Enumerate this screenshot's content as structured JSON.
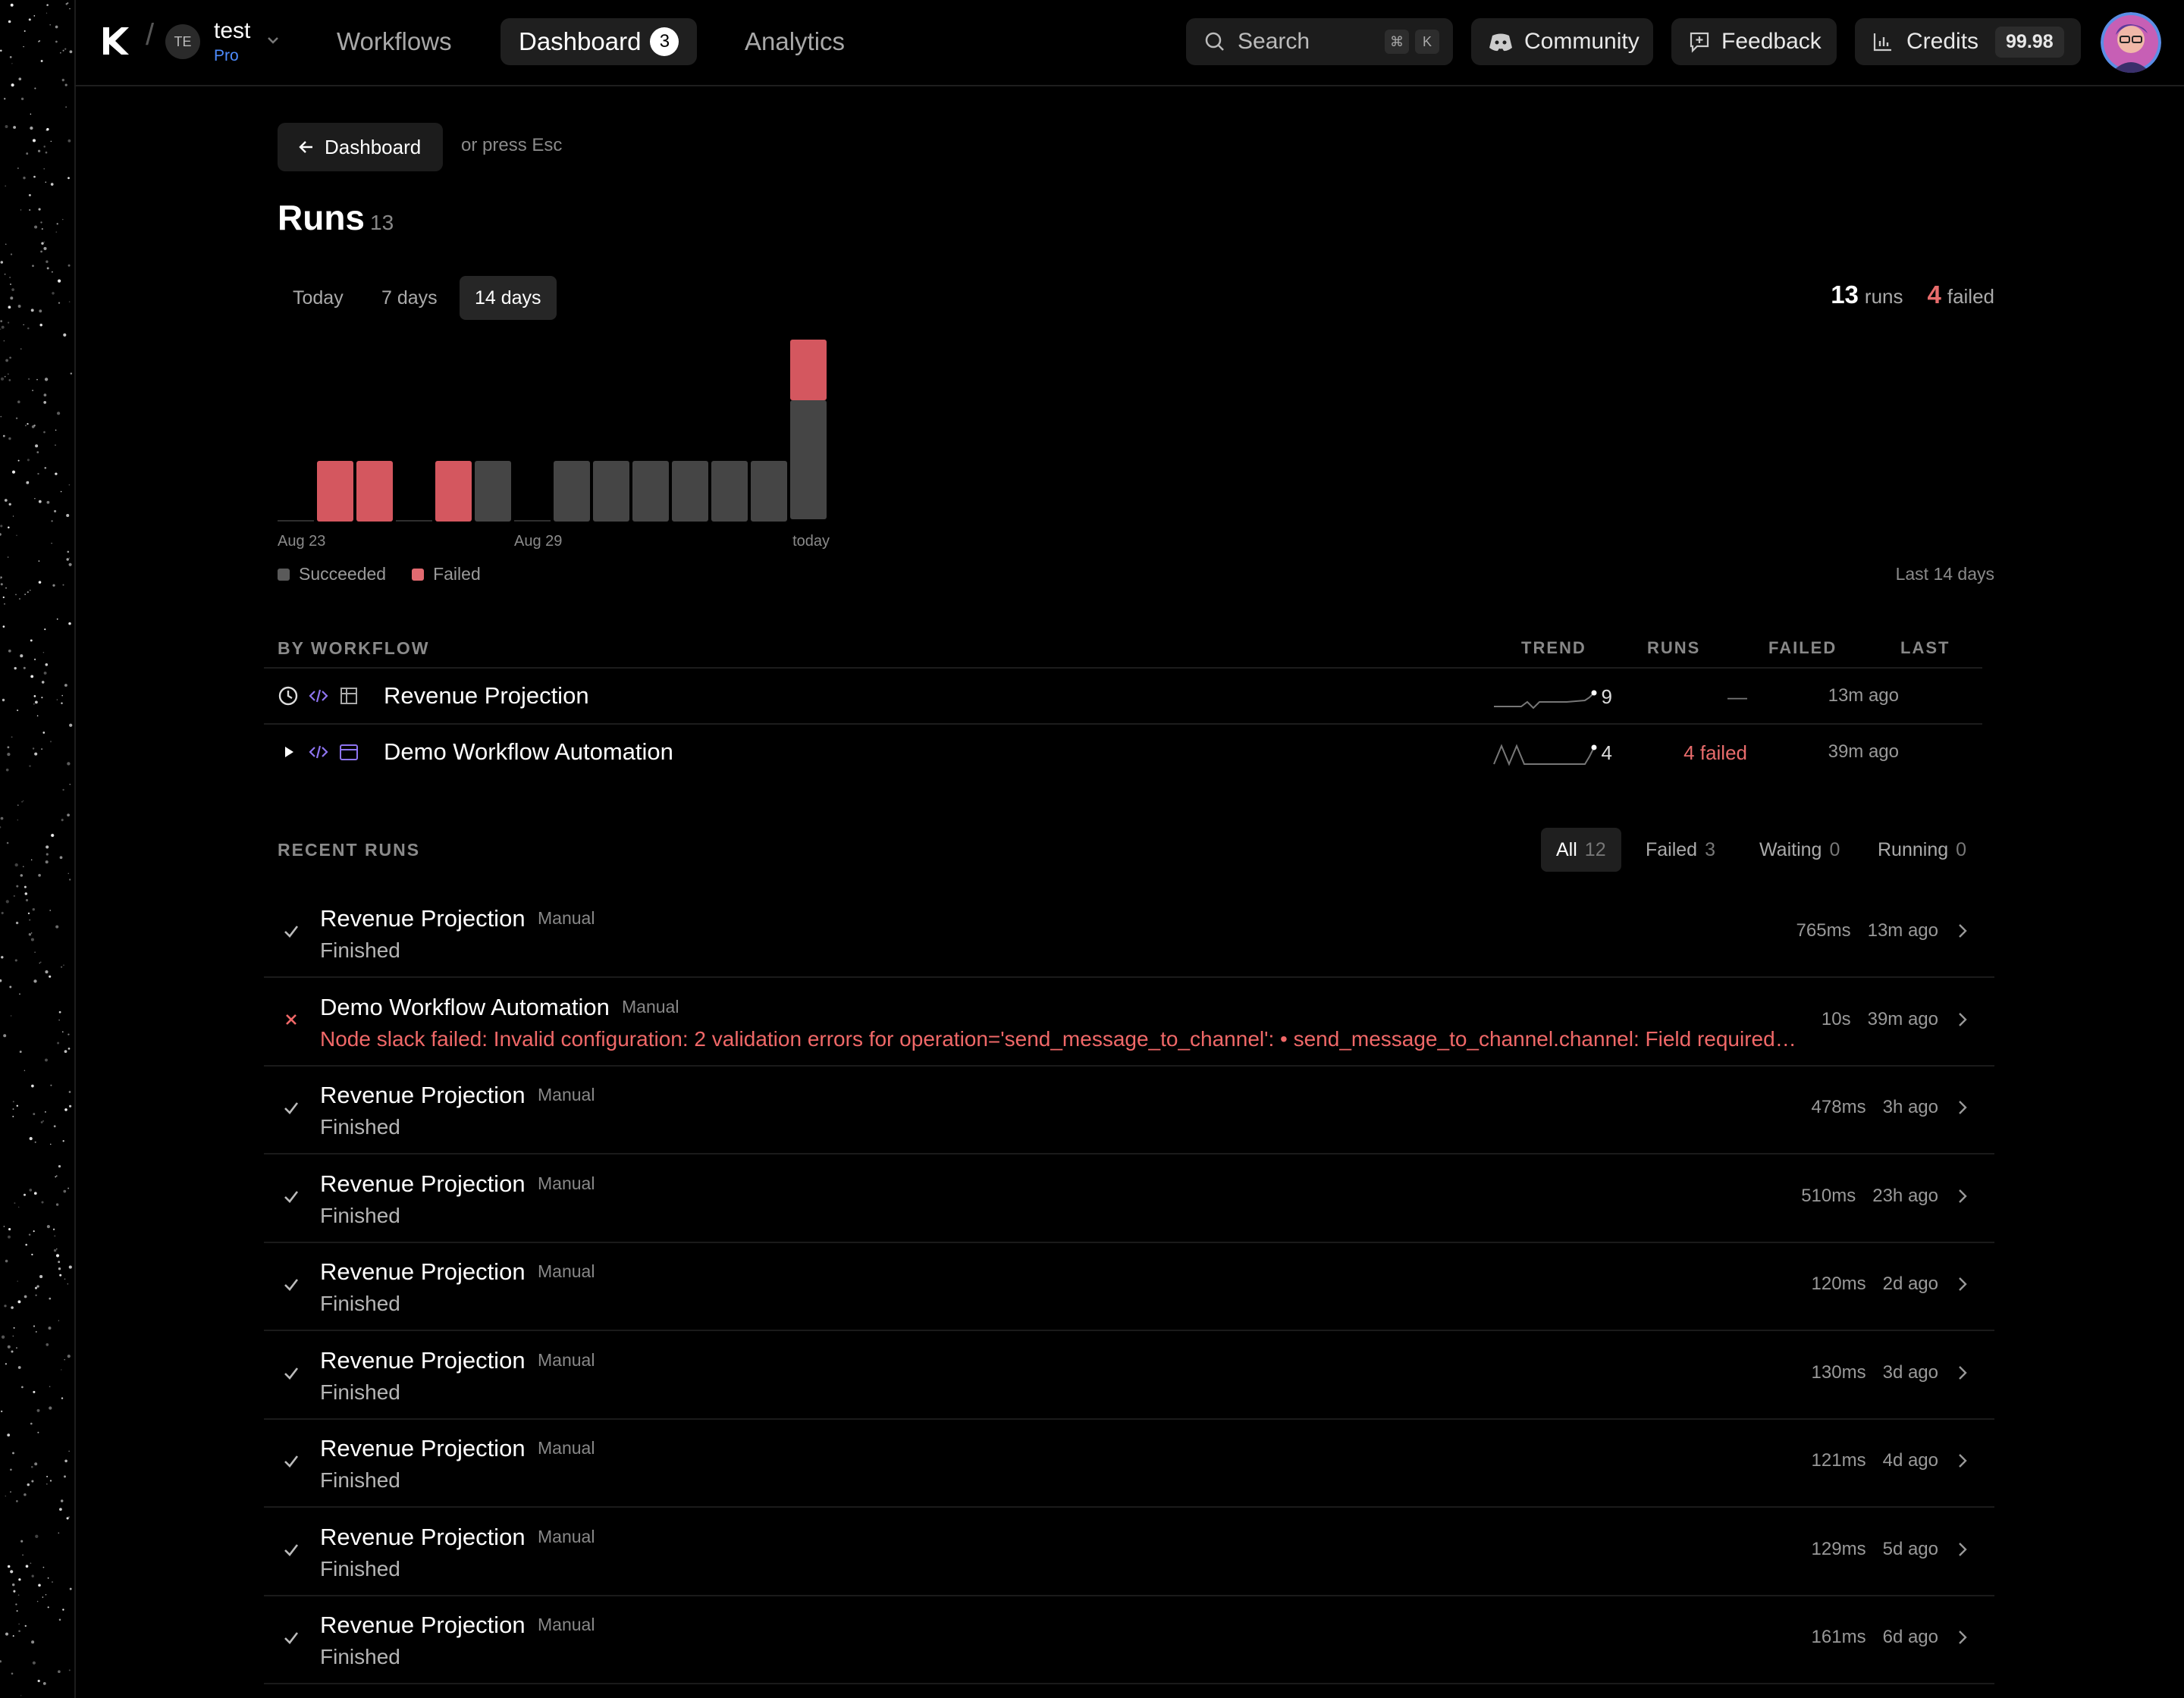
{
  "workspace": {
    "initials": "TE",
    "name": "test",
    "plan": "Pro"
  },
  "nav": {
    "workflows": "Workflows",
    "dashboard": "Dashboard",
    "dashboard_badge": "3",
    "analytics": "Analytics"
  },
  "topbar": {
    "search_label": "Search",
    "search_key1": "⌘",
    "search_key2": "K",
    "community": "Community",
    "feedback": "Feedback",
    "credits_label": "Credits",
    "credits_value": "99.98"
  },
  "page": {
    "back_label": "Dashboard",
    "back_hint": "or press Esc",
    "title": "Runs",
    "title_count": "13",
    "range_tabs": [
      "Today",
      "7 days",
      "14 days"
    ],
    "summary_runs": "13",
    "summary_runs_label": "runs",
    "summary_failed": "4",
    "summary_failed_label": "failed",
    "legend_succeeded": "Succeeded",
    "legend_failed": "Failed",
    "range_caption": "Last 14 days"
  },
  "chart_data": {
    "type": "bar",
    "stacked": true,
    "categories": [
      "Aug 23",
      "Aug 24",
      "Aug 25",
      "Aug 26",
      "Aug 27",
      "Aug 28",
      "Aug 29",
      "Aug 30",
      "Aug 31",
      "Sep 1",
      "Sep 2",
      "Sep 3",
      "Sep 4",
      "today"
    ],
    "x_tick_labels": [
      "Aug 23",
      "Aug 29",
      "today"
    ],
    "series": [
      {
        "name": "Succeeded",
        "color": "#454545",
        "values": [
          0,
          0,
          0,
          0,
          0,
          1,
          0,
          1,
          1,
          1,
          1,
          1,
          1,
          2
        ]
      },
      {
        "name": "Failed",
        "color": "#d4575f",
        "values": [
          0,
          1,
          1,
          0,
          1,
          0,
          0,
          0,
          0,
          0,
          0,
          0,
          0,
          1
        ]
      }
    ],
    "ylim": [
      0,
      3
    ]
  },
  "by_workflow": {
    "label": "BY WORKFLOW",
    "columns": {
      "trend": "TREND",
      "runs": "RUNS",
      "failed": "FAILED",
      "last": "LAST"
    },
    "rows": [
      {
        "name": "Revenue Projection",
        "runs": "9",
        "failed": "—",
        "last": "13m ago"
      },
      {
        "name": "Demo Workflow Automation",
        "runs": "4",
        "failed": "4 failed",
        "last": "39m ago"
      }
    ]
  },
  "recent_runs": {
    "label": "RECENT RUNS",
    "filters": [
      {
        "label": "All",
        "count": "12"
      },
      {
        "label": "Failed",
        "count": "3"
      },
      {
        "label": "Waiting",
        "count": "0"
      },
      {
        "label": "Running",
        "count": "0"
      }
    ],
    "rows": [
      {
        "name": "Revenue Projection",
        "trigger": "Manual",
        "status": "success",
        "sub": "Finished",
        "duration": "765ms",
        "ago": "13m ago"
      },
      {
        "name": "Demo Workflow Automation",
        "trigger": "Manual",
        "status": "failed",
        "sub": "Node slack failed: Invalid configuration: 2 validation errors for operation='send_message_to_channel': • send_message_to_channel.channel: Field required •...",
        "duration": "10s",
        "ago": "39m ago"
      },
      {
        "name": "Revenue Projection",
        "trigger": "Manual",
        "status": "success",
        "sub": "Finished",
        "duration": "478ms",
        "ago": "3h ago"
      },
      {
        "name": "Revenue Projection",
        "trigger": "Manual",
        "status": "success",
        "sub": "Finished",
        "duration": "510ms",
        "ago": "23h ago"
      },
      {
        "name": "Revenue Projection",
        "trigger": "Manual",
        "status": "success",
        "sub": "Finished",
        "duration": "120ms",
        "ago": "2d ago"
      },
      {
        "name": "Revenue Projection",
        "trigger": "Manual",
        "status": "success",
        "sub": "Finished",
        "duration": "130ms",
        "ago": "3d ago"
      },
      {
        "name": "Revenue Projection",
        "trigger": "Manual",
        "status": "success",
        "sub": "Finished",
        "duration": "121ms",
        "ago": "4d ago"
      },
      {
        "name": "Revenue Projection",
        "trigger": "Manual",
        "status": "success",
        "sub": "Finished",
        "duration": "129ms",
        "ago": "5d ago"
      },
      {
        "name": "Revenue Projection",
        "trigger": "Manual",
        "status": "success",
        "sub": "Finished",
        "duration": "161ms",
        "ago": "6d ago"
      }
    ]
  }
}
